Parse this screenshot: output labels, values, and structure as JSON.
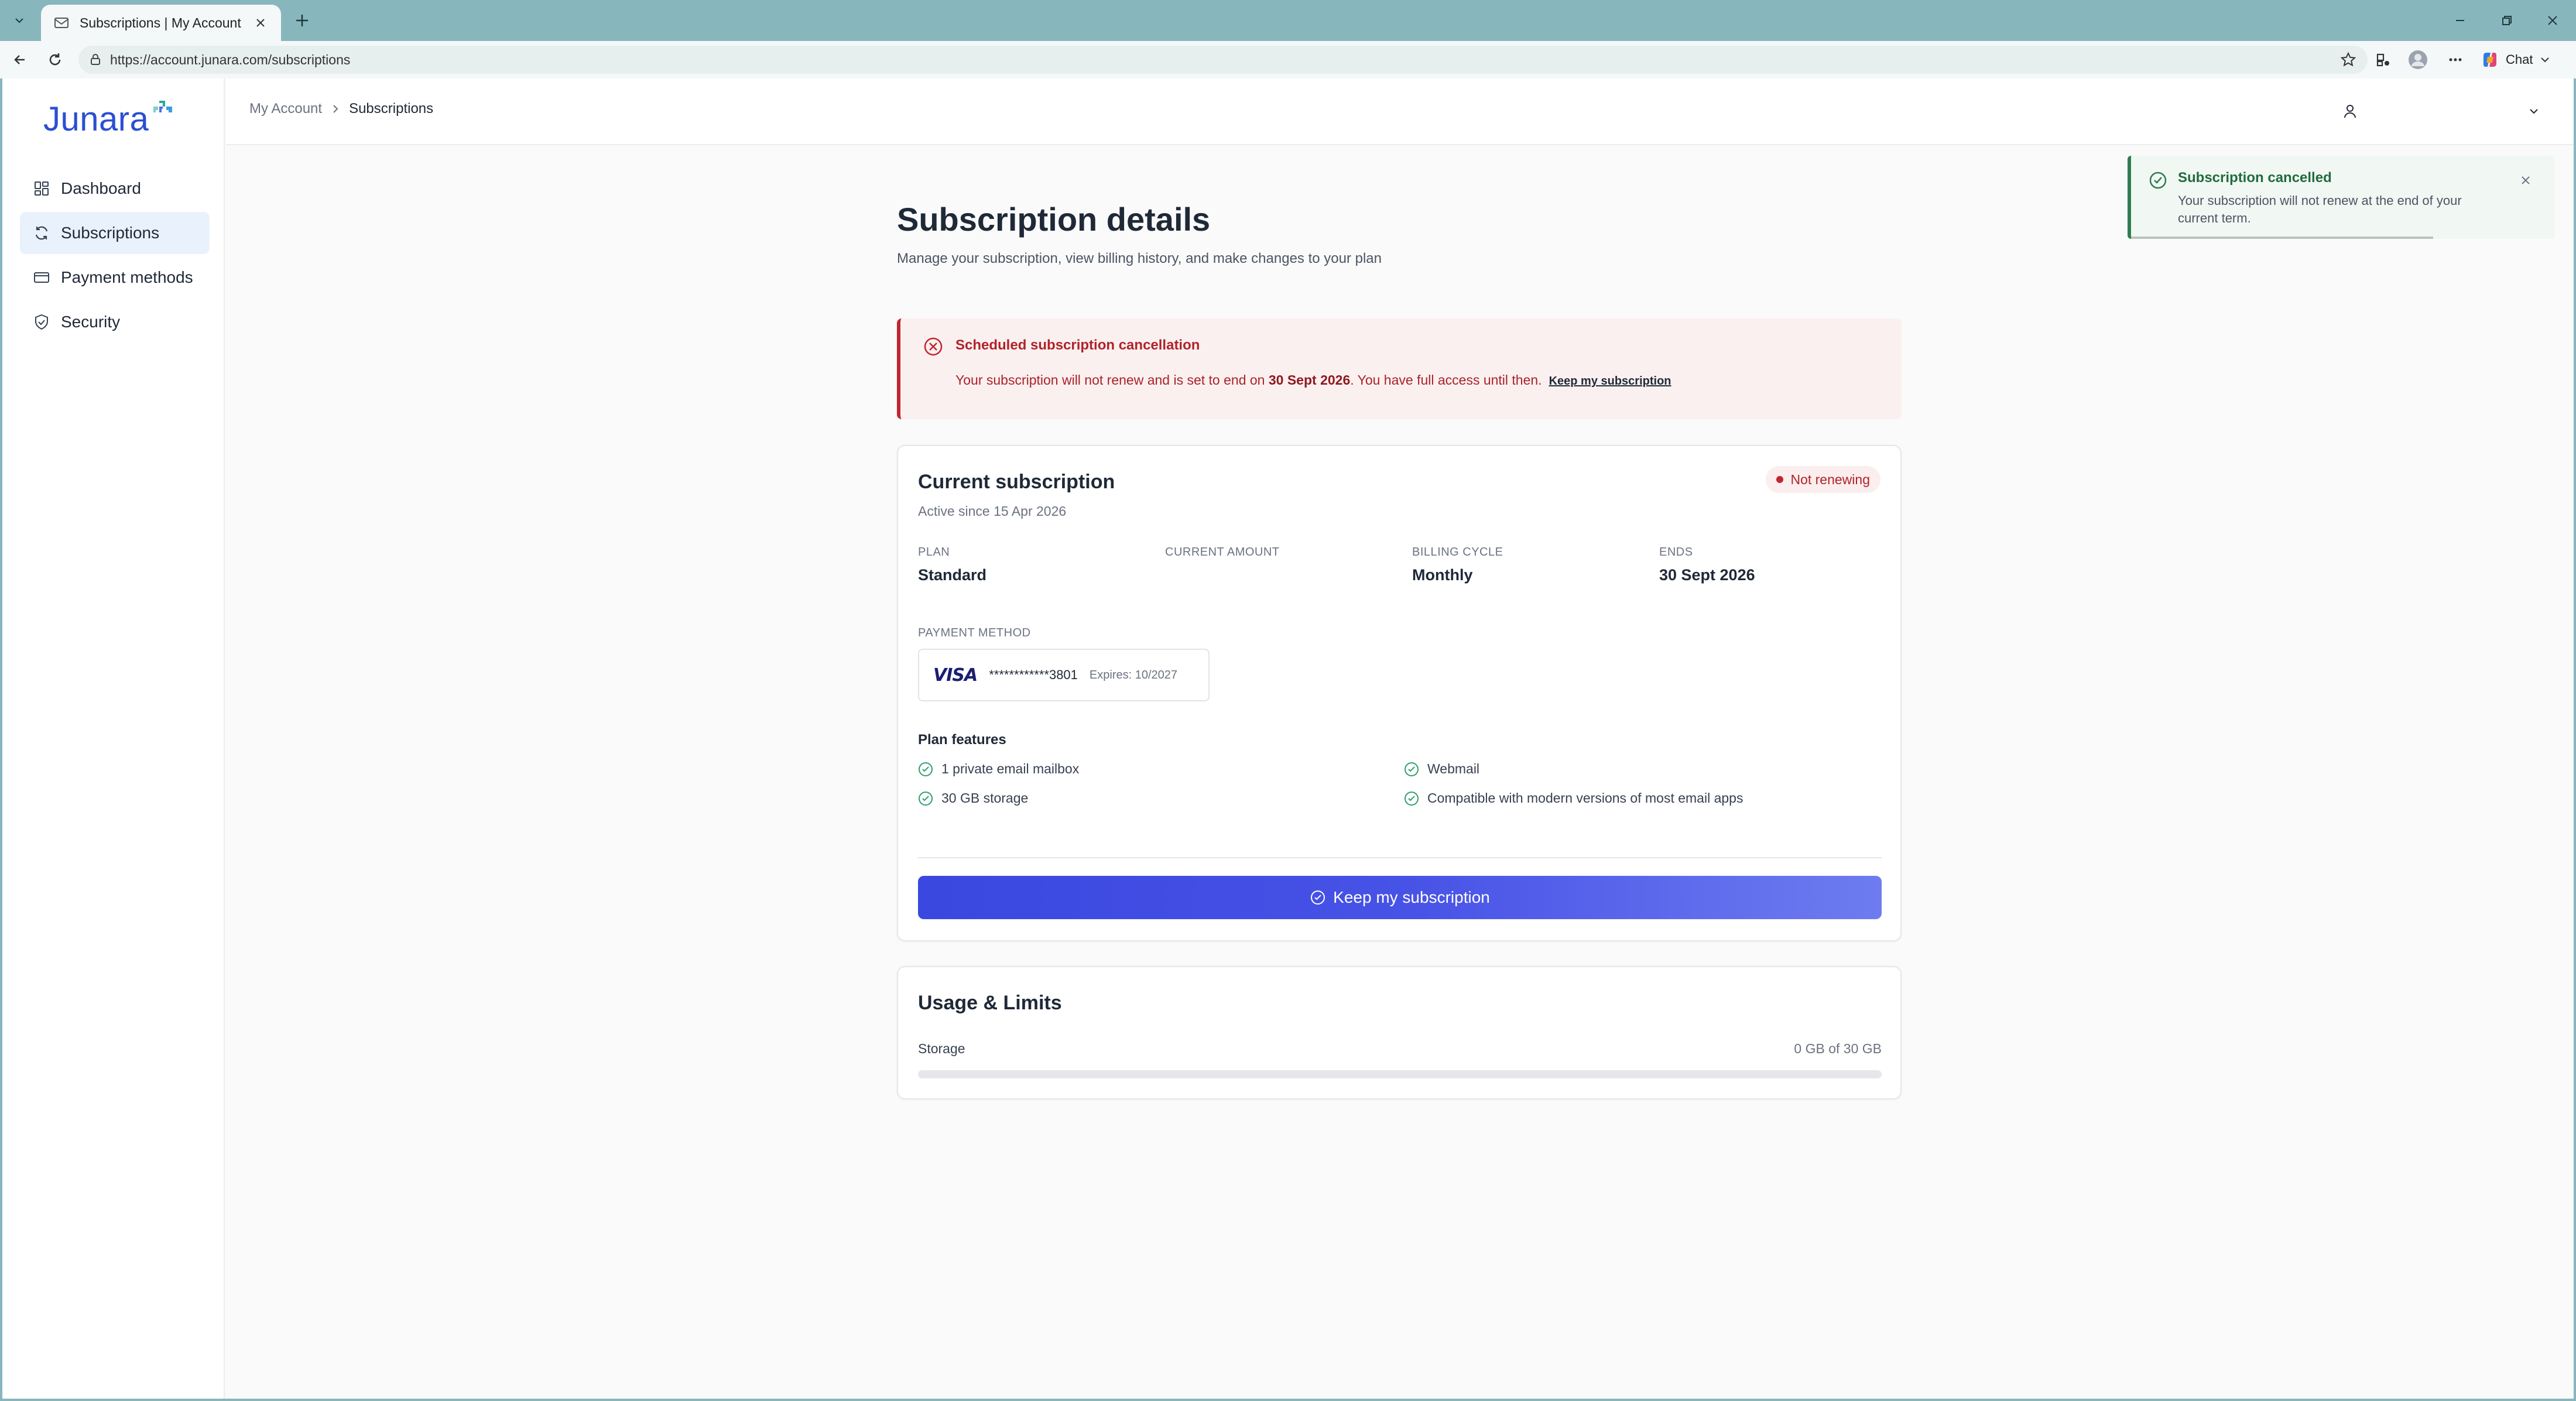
{
  "browser": {
    "tab_title": "Subscriptions | My Account",
    "url": "https://account.junara.com/subscriptions",
    "chat_label": "Chat"
  },
  "app": {
    "brand": "Junara",
    "accent": "#3a48e0"
  },
  "sidebar": {
    "items": [
      {
        "label": "Dashboard",
        "icon": "dashboard-icon",
        "active": false
      },
      {
        "label": "Subscriptions",
        "icon": "refresh-icon",
        "active": true
      },
      {
        "label": "Payment methods",
        "icon": "credit-card-icon",
        "active": false
      },
      {
        "label": "Security",
        "icon": "shield-icon",
        "active": false
      }
    ]
  },
  "header": {
    "breadcrumb": [
      "My Account",
      "Subscriptions"
    ]
  },
  "toast": {
    "title": "Subscription cancelled",
    "message": "Your subscription will not renew at the end of your current term.",
    "color": "#2e7d4f"
  },
  "page": {
    "title": "Subscription details",
    "subtitle": "Manage your subscription, view billing history, and make changes to your plan"
  },
  "alert": {
    "title": "Scheduled subscription cancellation",
    "message_pre": "Your subscription will not renew and is set to end on ",
    "message_date": "30 Sept 2026",
    "message_post": ". You have full access until then.",
    "link": "Keep my subscription",
    "color": "#c0262d"
  },
  "subscription": {
    "title": "Current subscription",
    "active_since": "Active since 15 Apr 2026",
    "status": "Not renewing",
    "fields": [
      {
        "label": "PLAN",
        "value": "Standard"
      },
      {
        "label": "CURRENT AMOUNT",
        "value": ""
      },
      {
        "label": "BILLING CYCLE",
        "value": "Monthly"
      },
      {
        "label": "ENDS",
        "value": "30 Sept 2026"
      }
    ],
    "payment_method": {
      "label": "PAYMENT METHOD",
      "brand": "VISA",
      "number": "************3801",
      "expires": "Expires: 10/2027"
    },
    "features_title": "Plan features",
    "features": [
      "1 private email mailbox",
      "Webmail",
      "30 GB storage",
      "Compatible with modern versions of most email apps"
    ],
    "keep_button": "Keep my subscription"
  },
  "usage": {
    "title": "Usage & Limits",
    "storage_label": "Storage",
    "storage_value": "0 GB of 30 GB",
    "storage_fraction": 0
  }
}
